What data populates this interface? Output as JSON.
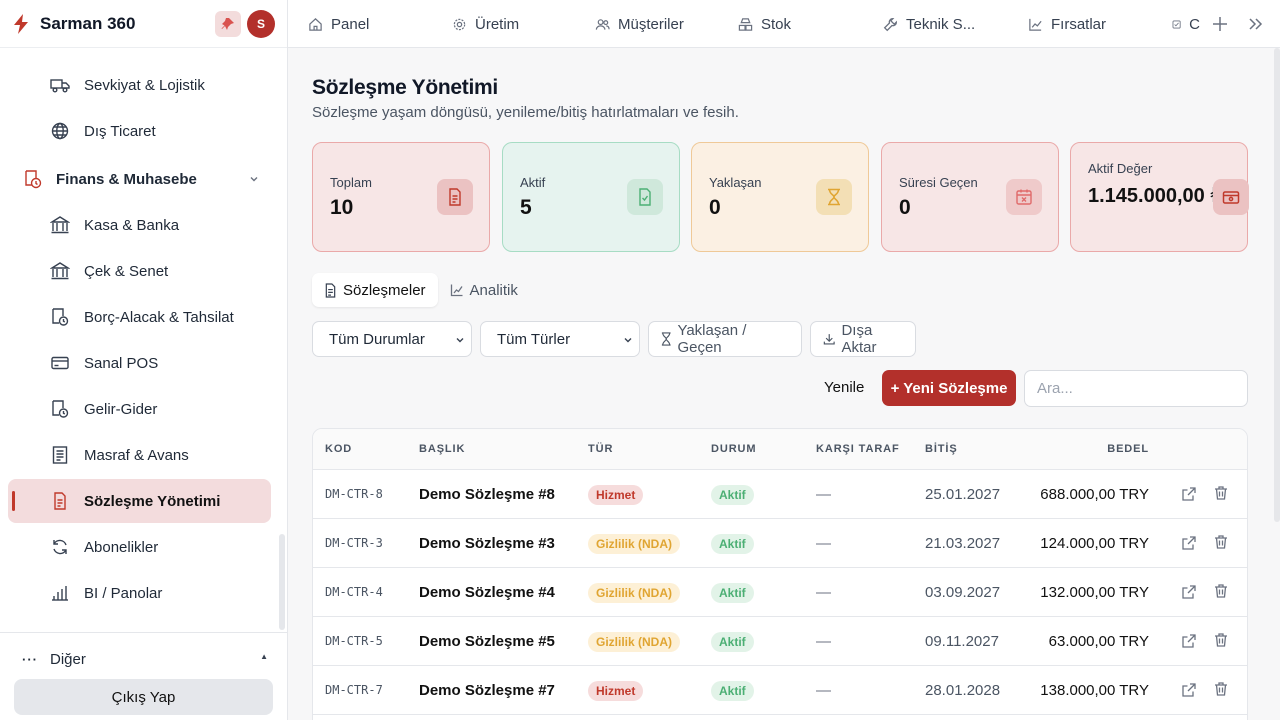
{
  "brand": {
    "name": "Sarman 360",
    "avatar_letter": "S",
    "accent": "#b3302b"
  },
  "sidebar": {
    "items": [
      {
        "label": "Sevkiyat & Lojistik",
        "icon": "truck-icon"
      },
      {
        "label": "Dış Ticaret",
        "icon": "globe-icon"
      },
      {
        "label": "Finans & Muhasebe",
        "icon": "finance-icon",
        "group": true
      },
      {
        "label": "Kasa & Banka",
        "icon": "bank-icon"
      },
      {
        "label": "Çek & Senet",
        "icon": "bank-icon"
      },
      {
        "label": "Borç-Alacak & Tahsilat",
        "icon": "receivable-icon"
      },
      {
        "label": "Sanal POS",
        "icon": "credit-card-icon"
      },
      {
        "label": "Gelir-Gider",
        "icon": "receivable-icon"
      },
      {
        "label": "Masraf & Avans",
        "icon": "receipt-icon"
      },
      {
        "label": "Sözleşme Yönetimi",
        "icon": "contract-icon",
        "active": true
      },
      {
        "label": "Abonelikler",
        "icon": "refresh-icon"
      },
      {
        "label": "BI / Panolar",
        "icon": "bar-chart-icon"
      }
    ],
    "other_label": "Diğer",
    "logout_label": "Çıkış Yap"
  },
  "topbar": {
    "tabs": [
      {
        "label": "Panel",
        "icon": "home-icon"
      },
      {
        "label": "Üretim",
        "icon": "gear-icon"
      },
      {
        "label": "Müşteriler",
        "icon": "users-icon"
      },
      {
        "label": "Stok",
        "icon": "boxes-icon"
      },
      {
        "label": "Teknik S...",
        "icon": "wrench-icon"
      },
      {
        "label": "Fırsatlar",
        "icon": "trend-icon"
      },
      {
        "label": "C",
        "icon": "checkbox-icon"
      }
    ]
  },
  "page": {
    "title": "Sözleşme Yönetimi",
    "subtitle": "Sözleşme yaşam döngüsü, yenileme/bitiş hatırlatmaları ve fesih."
  },
  "stats": [
    {
      "label": "Toplam",
      "value": "10",
      "icon": "document-icon",
      "bg": "#f7e6e6",
      "border": "#eaa9a9",
      "icon_bg": "#ebc2c2",
      "icon_color": "#c0392b"
    },
    {
      "label": "Aktif",
      "value": "5",
      "icon": "file-check-icon",
      "bg": "#e6f3ef",
      "border": "#a7dcc4",
      "icon_bg": "#cfe8db",
      "icon_color": "#4caf74"
    },
    {
      "label": "Yaklaşan",
      "value": "0",
      "icon": "hourglass-icon",
      "bg": "#fbf0e3",
      "border": "#efc998",
      "icon_bg": "#f3dfb5",
      "icon_color": "#e0a532"
    },
    {
      "label": "Süresi Geçen",
      "value": "0",
      "icon": "calendar-x-icon",
      "bg": "#f7e6e6",
      "border": "#eaa9a9",
      "icon_bg": "#efcaca",
      "icon_color": "#e06a6a"
    },
    {
      "label": "Aktif Değer",
      "value": "1.145.000,00 ₺",
      "icon": "wallet-icon",
      "bg": "#f7e6e6",
      "border": "#eaa9a9",
      "icon_bg": "#ebc2c2",
      "icon_color": "#c0392b"
    }
  ],
  "subtabs": [
    {
      "label": "Sözleşmeler",
      "icon": "document-icon",
      "active": true
    },
    {
      "label": "Analitik",
      "icon": "line-chart-icon"
    }
  ],
  "filters": {
    "status": "Tüm Durumlar",
    "type": "Tüm Türler",
    "due_label": "Yaklaşan / Geçen",
    "export_label": "Dışa Aktar"
  },
  "actions": {
    "refresh_label": "Yenile",
    "new_label": "+ Yeni Sözleşme",
    "search_placeholder": "Ara..."
  },
  "table": {
    "headers": [
      "KOD",
      "BAŞLIK",
      "TÜR",
      "DURUM",
      "KARŞI TARAF",
      "BİTİŞ",
      "BEDEL"
    ],
    "rows": [
      {
        "code": "DM-CTR-8",
        "title": "Demo Sözleşme #8",
        "type": "Hizmet",
        "status": "Aktif",
        "party": "—",
        "end": "25.01.2027",
        "amount": "688.000,00 TRY"
      },
      {
        "code": "DM-CTR-3",
        "title": "Demo Sözleşme #3",
        "type": "Gizlilik (NDA)",
        "status": "Aktif",
        "party": "—",
        "end": "21.03.2027",
        "amount": "124.000,00 TRY"
      },
      {
        "code": "DM-CTR-4",
        "title": "Demo Sözleşme #4",
        "type": "Gizlilik (NDA)",
        "status": "Aktif",
        "party": "—",
        "end": "03.09.2027",
        "amount": "132.000,00 TRY"
      },
      {
        "code": "DM-CTR-5",
        "title": "Demo Sözleşme #5",
        "type": "Gizlilik (NDA)",
        "status": "Aktif",
        "party": "—",
        "end": "09.11.2027",
        "amount": "63.000,00 TRY"
      },
      {
        "code": "DM-CTR-7",
        "title": "Demo Sözleşme #7",
        "type": "Hizmet",
        "status": "Aktif",
        "party": "—",
        "end": "28.01.2028",
        "amount": "138.000,00 TRY"
      }
    ]
  }
}
